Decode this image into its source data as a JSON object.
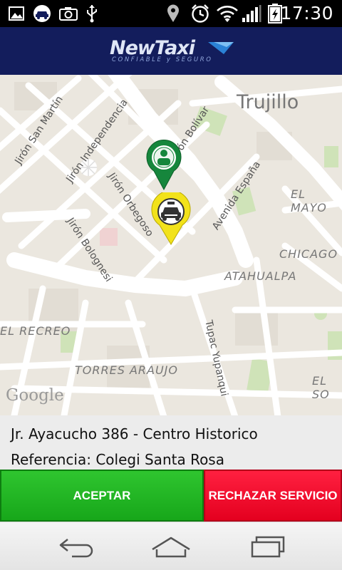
{
  "status_bar": {
    "time": "17:30",
    "icons": [
      "gallery-icon",
      "taxi-notification-icon",
      "camera-icon",
      "usb-icon",
      "location-icon",
      "alarm-icon",
      "wifi-icon",
      "signal-icon",
      "battery-charging-icon"
    ]
  },
  "app_bar": {
    "logo_text": "NewTaxi",
    "logo_tagline": "CONFIABLE y SEGURO",
    "brand_color": "#131d5c"
  },
  "map": {
    "city_label": "Trujillo",
    "street_labels": [
      "Jirón San Martín",
      "Jirón Independencia",
      "Jirón Bolívar",
      "Jirón Orbegoso",
      "Jirón Bolognesi",
      "Avenida España",
      "EL MAYO",
      "CHICAGO",
      "ATAHUALPA",
      "EL RECREO",
      "TORRES ARAUJO",
      "Tupac Yupanqui",
      "EL SO"
    ],
    "attribution": "Google",
    "markers": [
      {
        "type": "passenger",
        "icon": "person-marker-icon",
        "color": "#16863c"
      },
      {
        "type": "taxi",
        "icon": "taxi-marker-icon",
        "color": "#f2e21a"
      }
    ]
  },
  "request": {
    "address": "Jr. Ayacucho 386 - Centro Historico",
    "reference": "Referencia: Colegi Santa Rosa"
  },
  "actions": {
    "accept_label": "ACEPTAR",
    "reject_label": "RECHAZAR SERVICIO",
    "accept_color": "#1fb521",
    "reject_color": "#f20a2c"
  },
  "nav_bar": {
    "buttons": [
      "back-icon",
      "home-icon",
      "recent-apps-icon"
    ]
  }
}
